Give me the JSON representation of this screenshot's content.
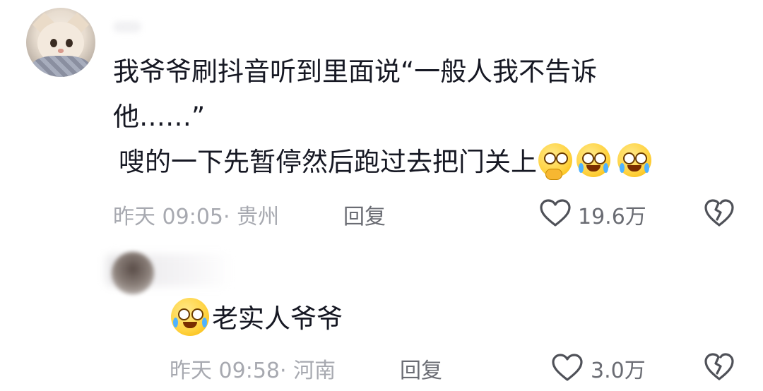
{
  "comments": [
    {
      "text_line_1": "我爷爷刷抖音听到里面说“一般人我不告诉",
      "text_line_2": "他……”",
      "text_line_3": "嗖的一下先暂停然后跑过去把门关上",
      "emojis": [
        "thinking-face-emoji",
        "crying-laughing-emoji",
        "crying-laughing-emoji"
      ],
      "time": "昨天 09:05",
      "location": "· 贵州",
      "reply_label": "回复",
      "like_count": "19.6万"
    }
  ],
  "reply": {
    "text": "老实人爷爷",
    "emoji": "rolling-laughing-emoji",
    "time": "昨天 09:58",
    "location": "· 河南",
    "reply_label": "回复",
    "like_count": "3.0万"
  },
  "icons": {
    "like": "heart-outline-icon",
    "dislike": "broken-heart-icon"
  }
}
